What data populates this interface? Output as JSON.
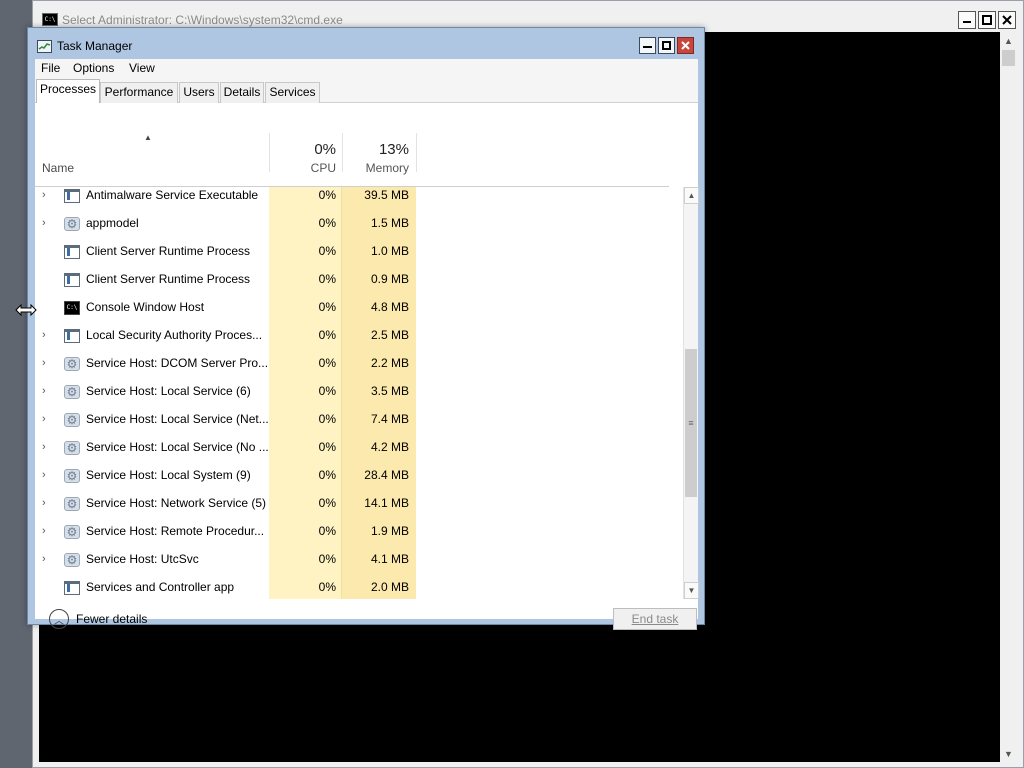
{
  "cmd_window": {
    "title": "Select Administrator: C:\\Windows\\system32\\cmd.exe",
    "icon": "console-icon"
  },
  "task_manager": {
    "title": "Task Manager",
    "icon": "task-manager-icon",
    "menu": [
      "File",
      "Options",
      "View"
    ],
    "tabs": [
      "Processes",
      "Performance",
      "Users",
      "Details",
      "Services"
    ],
    "active_tab": "Processes",
    "columns": {
      "name": "Name",
      "cpu_total": "0%",
      "cpu": "CPU",
      "memory_total": "13%",
      "memory": "Memory"
    },
    "processes": [
      {
        "name": "Antimalware Service Executable",
        "cpu": "0%",
        "memory": "39.5 MB",
        "expandable": true,
        "icon": "app-icon"
      },
      {
        "name": "appmodel",
        "cpu": "0%",
        "memory": "1.5 MB",
        "expandable": true,
        "icon": "gear-icon"
      },
      {
        "name": "Client Server Runtime Process",
        "cpu": "0%",
        "memory": "1.0 MB",
        "expandable": false,
        "icon": "app-icon"
      },
      {
        "name": "Client Server Runtime Process",
        "cpu": "0%",
        "memory": "0.9 MB",
        "expandable": false,
        "icon": "app-icon"
      },
      {
        "name": "Console Window Host",
        "cpu": "0%",
        "memory": "4.8 MB",
        "expandable": false,
        "icon": "console-icon"
      },
      {
        "name": "Local Security Authority Proces...",
        "cpu": "0%",
        "memory": "2.5 MB",
        "expandable": true,
        "icon": "app-icon"
      },
      {
        "name": "Service Host: DCOM Server Pro...",
        "cpu": "0%",
        "memory": "2.2 MB",
        "expandable": true,
        "icon": "gear-icon"
      },
      {
        "name": "Service Host: Local Service (6)",
        "cpu": "0%",
        "memory": "3.5 MB",
        "expandable": true,
        "icon": "gear-icon"
      },
      {
        "name": "Service Host: Local Service (Net...",
        "cpu": "0%",
        "memory": "7.4 MB",
        "expandable": true,
        "icon": "gear-icon"
      },
      {
        "name": "Service Host: Local Service (No ...",
        "cpu": "0%",
        "memory": "4.2 MB",
        "expandable": true,
        "icon": "gear-icon"
      },
      {
        "name": "Service Host: Local System (9)",
        "cpu": "0%",
        "memory": "28.4 MB",
        "expandable": true,
        "icon": "gear-icon"
      },
      {
        "name": "Service Host: Network Service (5)",
        "cpu": "0%",
        "memory": "14.1 MB",
        "expandable": true,
        "icon": "gear-icon"
      },
      {
        "name": "Service Host: Remote Procedur...",
        "cpu": "0%",
        "memory": "1.9 MB",
        "expandable": true,
        "icon": "gear-icon"
      },
      {
        "name": "Service Host: UtcSvc",
        "cpu": "0%",
        "memory": "4.1 MB",
        "expandable": true,
        "icon": "gear-icon"
      },
      {
        "name": "Services and Controller app",
        "cpu": "0%",
        "memory": "2.0 MB",
        "expandable": false,
        "icon": "app-icon"
      }
    ],
    "footer": {
      "fewer_details": "Fewer details",
      "end_task": "End task"
    }
  }
}
